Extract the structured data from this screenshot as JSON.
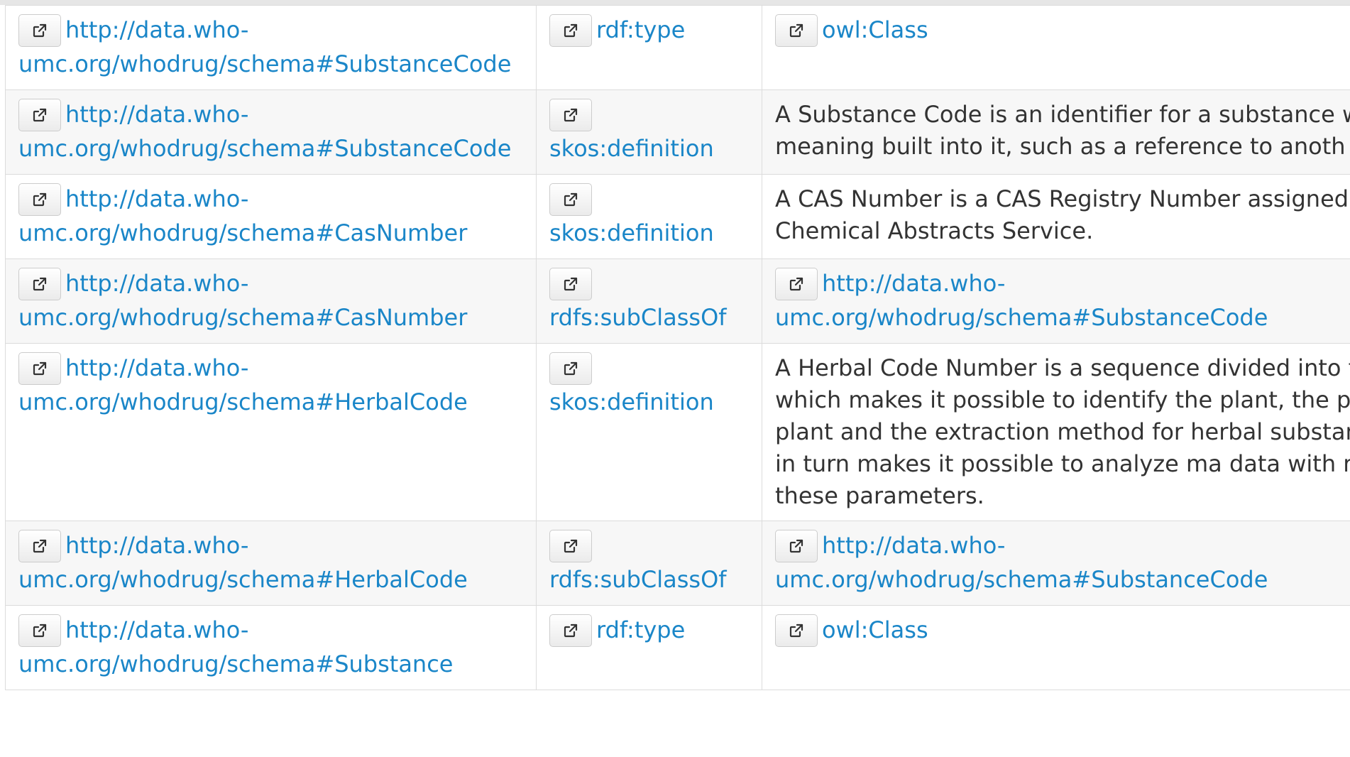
{
  "rows": [
    {
      "subject": "http://data.who-umc.org/whodrug/schema#SubstanceCode",
      "predicate": "rdf:type",
      "object": {
        "type": "link",
        "text": "owl:Class"
      }
    },
    {
      "subject": "http://data.who-umc.org/whodrug/schema#SubstanceCode",
      "predicate": "skos:definition",
      "object": {
        "type": "literal",
        "text": "A Substance Code is an identifier for a substance which some meaning built into it, such as a reference to anoth source."
      }
    },
    {
      "subject": "http://data.who-umc.org/whodrug/schema#CasNumber",
      "predicate": "skos:definition",
      "object": {
        "type": "literal",
        "text": "A CAS Number is a CAS Registry Number assigned by Chemical Abstracts Service."
      }
    },
    {
      "subject": "http://data.who-umc.org/whodrug/schema#CasNumber",
      "predicate": "rdfs:subClassOf",
      "object": {
        "type": "link",
        "text": "http://data.who-umc.org/whodrug/schema#SubstanceCode"
      }
    },
    {
      "subject": "http://data.who-umc.org/whodrug/schema#HerbalCode",
      "predicate": "skos:definition",
      "object": {
        "type": "literal",
        "text": "A Herbal Code Number is a sequence divided into three parts which makes it possible to identify the plant, the p of the plant and the extraction method for herbal substances. This in turn makes it possible to analyze ma data with respect to these parameters."
      }
    },
    {
      "subject": "http://data.who-umc.org/whodrug/schema#HerbalCode",
      "predicate": "rdfs:subClassOf",
      "object": {
        "type": "link",
        "text": "http://data.who-umc.org/whodrug/schema#SubstanceCode"
      }
    },
    {
      "subject": "http://data.who-umc.org/whodrug/schema#Substance",
      "predicate": "rdf:type",
      "object": {
        "type": "link",
        "text": "owl:Class"
      }
    }
  ],
  "icons": {
    "external_link": "external-link-icon"
  },
  "colors": {
    "link": "#1a86c8",
    "text": "#333333",
    "border": "#dcdcdc",
    "row_alt": "#f7f7f7"
  }
}
